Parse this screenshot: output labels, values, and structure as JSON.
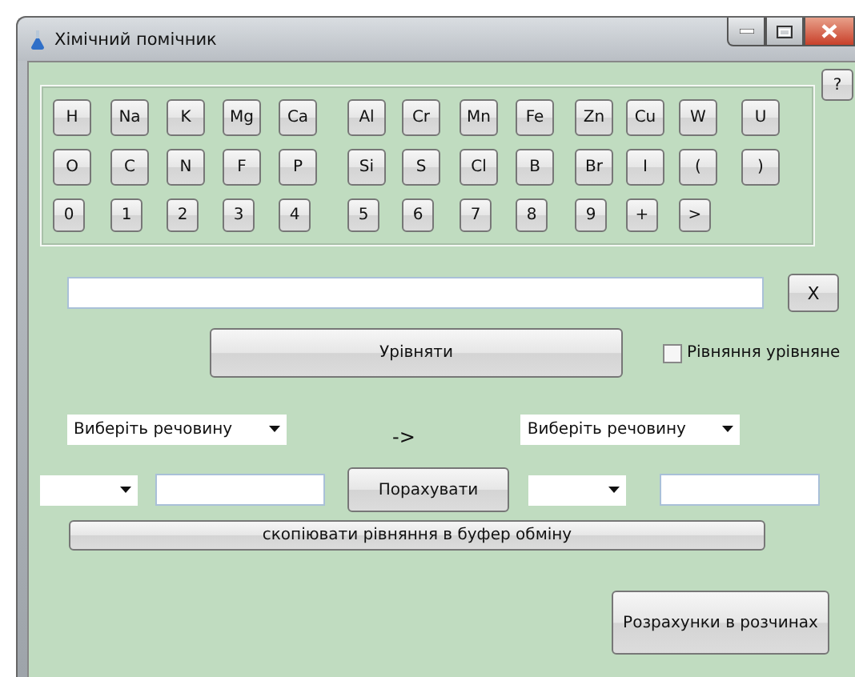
{
  "window": {
    "title": "Хімічний помічник"
  },
  "help_button": "?",
  "keypad": {
    "rows": [
      [
        "H",
        "Na",
        "K",
        "Mg",
        "Ca",
        "Al",
        "Cr",
        "Mn",
        "Fe",
        "Zn",
        "Cu",
        "W",
        "U"
      ],
      [
        "O",
        "C",
        "N",
        "F",
        "P",
        "Si",
        "S",
        "Cl",
        "B",
        "Br",
        "I",
        "(",
        ")"
      ],
      [
        "0",
        "1",
        "2",
        "3",
        "4",
        "5",
        "6",
        "7",
        "8",
        "9",
        "+",
        ">"
      ]
    ]
  },
  "clear_button": "X",
  "balance_button": "Урівняти",
  "balanced_checkbox": {
    "label": "Рівняння урівняне",
    "checked": false
  },
  "reactant_select": {
    "value": "Виберіть речовину"
  },
  "arrow": "->",
  "product_select": {
    "value": "Виберіть речовину"
  },
  "calculate_button": "Порахувати",
  "copy_button": "скопіювати рівняння в буфер обміну",
  "solutions_button": "Розрахунки в розчинах"
}
